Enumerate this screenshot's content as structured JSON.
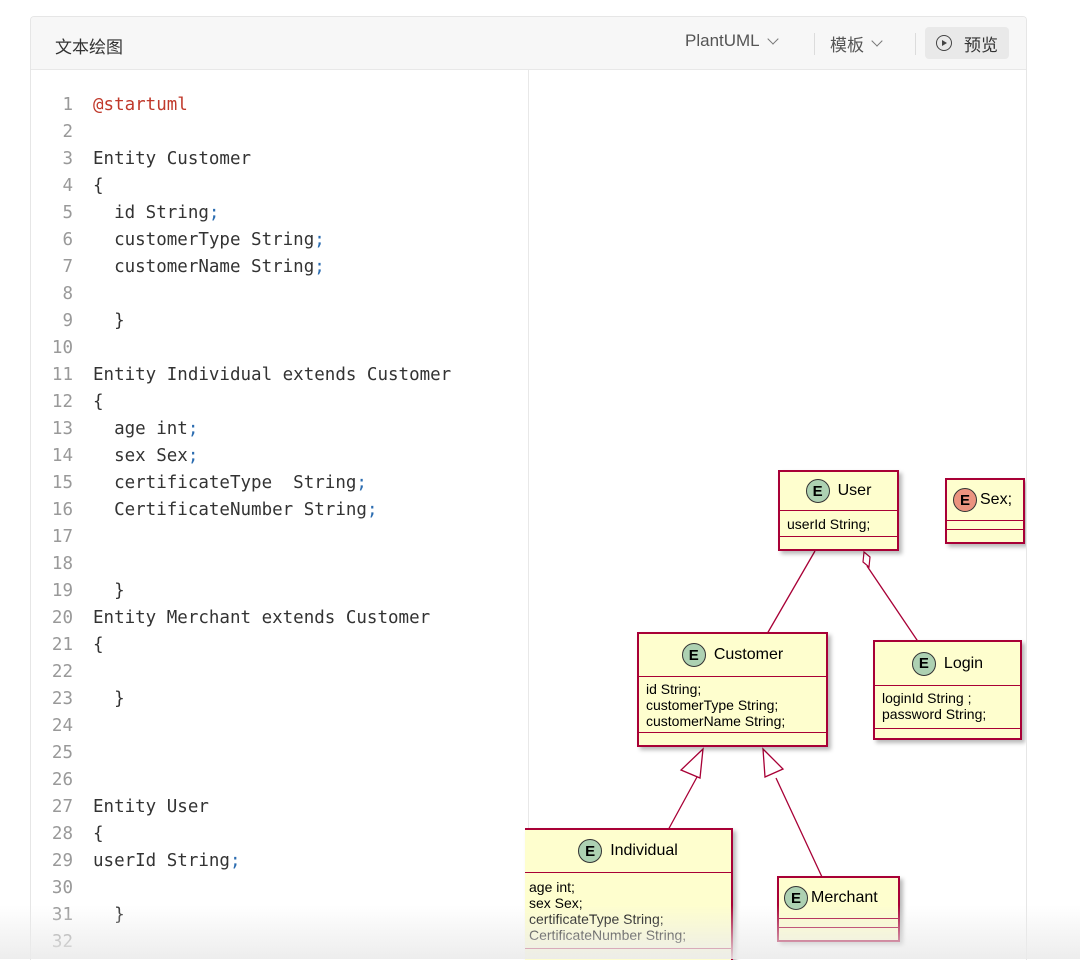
{
  "header": {
    "title": "文本绘图",
    "language_select": "PlantUML",
    "template_select": "模板",
    "preview_button": "预览",
    "icons": {
      "dropdown": "chevron-down-icon",
      "preview": "play-circle-icon"
    }
  },
  "editor": {
    "lines": [
      {
        "n": "1",
        "text": "@startuml"
      },
      {
        "n": "2",
        "text": ""
      },
      {
        "n": "3",
        "text": "Entity Customer"
      },
      {
        "n": "4",
        "text": "{"
      },
      {
        "n": "5",
        "text": "  id String;"
      },
      {
        "n": "6",
        "text": "  customerType String;"
      },
      {
        "n": "7",
        "text": "  customerName String;"
      },
      {
        "n": "8",
        "text": ""
      },
      {
        "n": "9",
        "text": "  }"
      },
      {
        "n": "10",
        "text": ""
      },
      {
        "n": "11",
        "text": "Entity Individual extends Customer"
      },
      {
        "n": "12",
        "text": "{"
      },
      {
        "n": "13",
        "text": "  age int;"
      },
      {
        "n": "14",
        "text": "  sex Sex;"
      },
      {
        "n": "15",
        "text": "  certificateType  String;"
      },
      {
        "n": "16",
        "text": "  CertificateNumber String;"
      },
      {
        "n": "17",
        "text": ""
      },
      {
        "n": "18",
        "text": ""
      },
      {
        "n": "19",
        "text": "  }"
      },
      {
        "n": "20",
        "text": "Entity Merchant extends Customer"
      },
      {
        "n": "21",
        "text": "{"
      },
      {
        "n": "22",
        "text": ""
      },
      {
        "n": "23",
        "text": "  }"
      },
      {
        "n": "24",
        "text": ""
      },
      {
        "n": "25",
        "text": ""
      },
      {
        "n": "26",
        "text": ""
      },
      {
        "n": "27",
        "text": "Entity User"
      },
      {
        "n": "28",
        "text": "{"
      },
      {
        "n": "29",
        "text": "userId String;"
      },
      {
        "n": "30",
        "text": ""
      },
      {
        "n": "31",
        "text": "  }"
      },
      {
        "n": "32",
        "text": ""
      }
    ]
  },
  "diagram": {
    "entities": {
      "user": {
        "badge": "E",
        "name": "User",
        "attributes": [
          "userId String;"
        ]
      },
      "sex": {
        "badge": "E",
        "name": "Sex;",
        "attributes": []
      },
      "customer": {
        "badge": "E",
        "name": "Customer",
        "attributes": [
          "id String;",
          "customerType String;",
          "customerName String;"
        ]
      },
      "login": {
        "badge": "E",
        "name": "Login",
        "attributes": [
          "loginId String ;",
          "password String;"
        ]
      },
      "individual": {
        "badge": "E",
        "name": "Individual",
        "attributes": [
          "age int;",
          "sex Sex;",
          "certificateType String;",
          "CertificateNumber String;"
        ]
      },
      "merchant": {
        "badge": "E",
        "name": "Merchant",
        "attributes": []
      }
    },
    "colors": {
      "fill": "#fefece",
      "border": "#a80036",
      "badge_entity": "#add1b2",
      "badge_enum": "#eb937f"
    }
  }
}
